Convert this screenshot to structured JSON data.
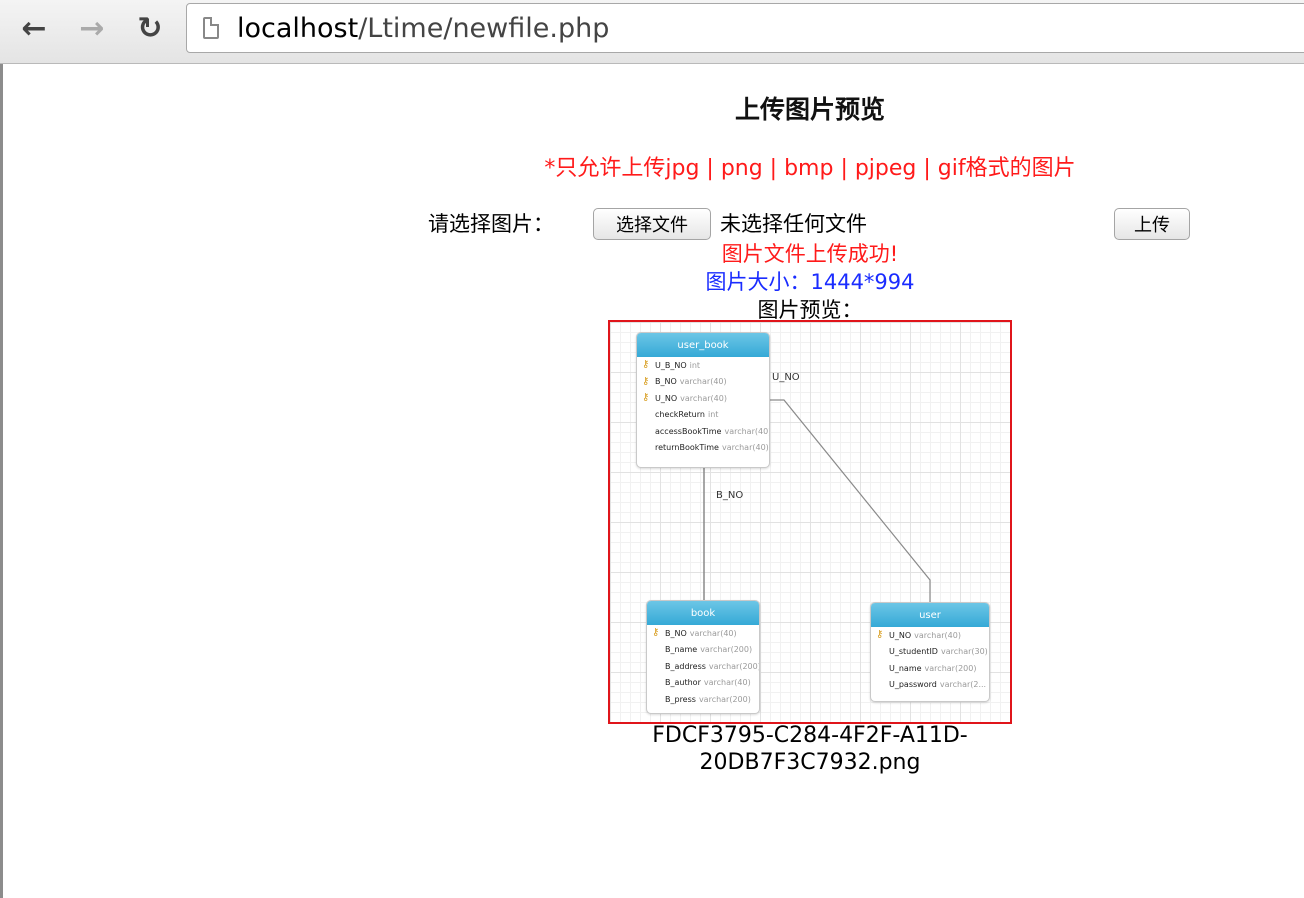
{
  "browser": {
    "url_host": "localhost",
    "url_path": "/Ltime/newfile.php"
  },
  "page": {
    "title": "上传图片预览",
    "notice": "*只允许上传jpg | png | bmp | pjpeg | gif格式的图片",
    "choose_label": "请选择图片：",
    "choose_button": "选择文件",
    "no_file_text": "未选择任何文件",
    "upload_button": "上传",
    "success_message": "图片文件上传成功!",
    "size_text": "图片大小：1444*994",
    "preview_label": "图片预览：",
    "filename": "FDCF3795-C284-4F2F-A11D-20DB7F3C7932.png"
  },
  "diagram": {
    "tables": {
      "user_book": {
        "name": "user_book",
        "fields": [
          {
            "name": "U_B_NO",
            "type": "int",
            "key": true
          },
          {
            "name": "B_NO",
            "type": "varchar(40)",
            "key": true
          },
          {
            "name": "U_NO",
            "type": "varchar(40)",
            "key": true
          },
          {
            "name": "checkReturn",
            "type": "int",
            "key": false
          },
          {
            "name": "accessBookTime",
            "type": "varchar(40)",
            "key": false
          },
          {
            "name": "returnBookTime",
            "type": "varchar(40)",
            "key": false
          }
        ]
      },
      "book": {
        "name": "book",
        "fields": [
          {
            "name": "B_NO",
            "type": "varchar(40)",
            "key": true
          },
          {
            "name": "B_name",
            "type": "varchar(200)",
            "key": false
          },
          {
            "name": "B_address",
            "type": "varchar(200)",
            "key": false
          },
          {
            "name": "B_author",
            "type": "varchar(40)",
            "key": false
          },
          {
            "name": "B_press",
            "type": "varchar(200)",
            "key": false
          }
        ]
      },
      "user": {
        "name": "user",
        "fields": [
          {
            "name": "U_NO",
            "type": "varchar(40)",
            "key": true
          },
          {
            "name": "U_studentID",
            "type": "varchar(30)",
            "key": false
          },
          {
            "name": "U_name",
            "type": "varchar(200)",
            "key": false
          },
          {
            "name": "U_password",
            "type": "varchar(2...",
            "key": false
          }
        ]
      }
    },
    "relations": {
      "u_no": "U_NO",
      "b_no": "B_NO"
    }
  },
  "colors": {
    "notice": "#ff1a1a",
    "size_text": "#1a2cff",
    "preview_border": "#e0151b",
    "table_header": "#35a9d6"
  }
}
